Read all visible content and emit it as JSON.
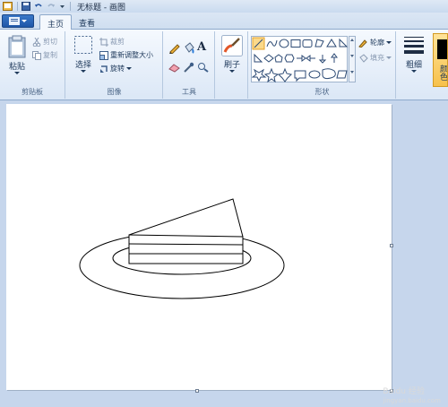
{
  "window": {
    "title": "无标题 - 画图"
  },
  "tabs": [
    {
      "label": "主页"
    },
    {
      "label": "查看"
    }
  ],
  "clipboard": {
    "paste": "粘贴",
    "cut": "剪切",
    "copy": "复制",
    "label": "剪贴板"
  },
  "image": {
    "select": "选择",
    "crop": "裁剪",
    "resize": "重新调整大小",
    "rotate": "旋转",
    "label": "图像"
  },
  "tools": {
    "label": "工具"
  },
  "brushes": {
    "label": "刷子"
  },
  "shapes": {
    "outline": "轮廓",
    "fill": "填充",
    "label": "形状"
  },
  "size": {
    "label": "粗细"
  },
  "colors": {
    "color1": "颜色"
  },
  "watermark": {
    "text": "Baidu 经验",
    "url": "jingyan.baidu.com"
  }
}
